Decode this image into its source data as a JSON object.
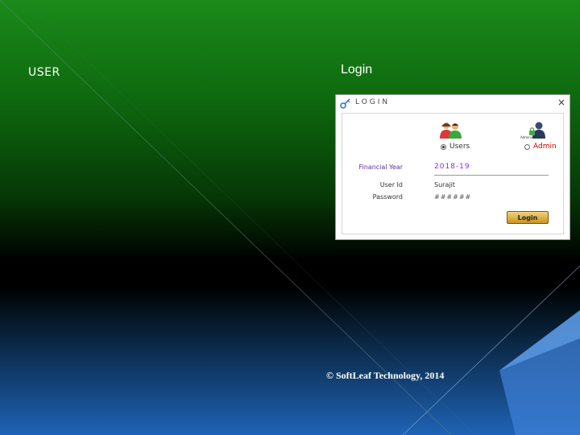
{
  "slide": {
    "user_label": "USER",
    "login_heading": "Login",
    "footer": "© SoftLeaf Technology, 2014"
  },
  "dialog": {
    "title": "LOGIN",
    "close_glyph": "×",
    "admin_caption": "Administrator",
    "roles": [
      {
        "label": "Users",
        "selected": true
      },
      {
        "label": "Admin",
        "selected": false
      }
    ],
    "fields": {
      "financial_year_label": "Financial Year",
      "financial_year_value": "2018-19",
      "user_id_label": "User Id",
      "user_id_value": "Surajit",
      "password_label": "Password",
      "password_value": "######"
    },
    "login_button": "Login"
  },
  "colors": {
    "admin_label": "#cc0000",
    "financial_year": "#8a2be2",
    "login_button": "#e0b03a"
  },
  "icons": [
    "key-icon",
    "users-icon",
    "admin-icon",
    "close-icon"
  ]
}
